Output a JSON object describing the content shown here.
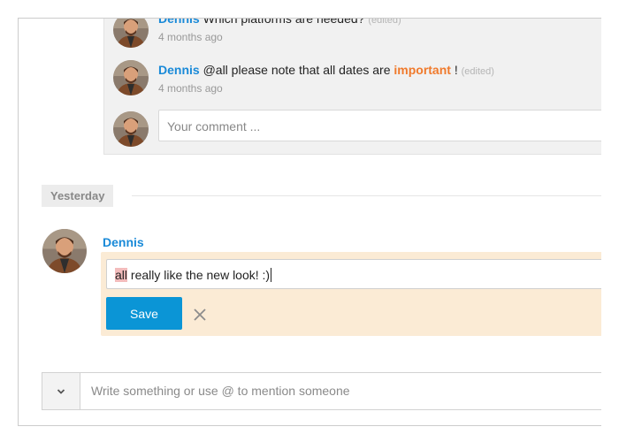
{
  "thread": {
    "comments": [
      {
        "author": "Dennis",
        "text": "Which platforms are needed?",
        "edited": "(edited)",
        "time": "4 months ago"
      },
      {
        "author": "Dennis",
        "text_before": "@all please note that all dates are",
        "highlight": "important",
        "text_after": "!",
        "edited": "(edited)",
        "time": "4 months ago"
      }
    ],
    "comment_placeholder": "Your comment ..."
  },
  "day_divider": "Yesterday",
  "edit": {
    "author": "Dennis",
    "mention": "all",
    "text": " really like the new look! :)",
    "save_label": "Save",
    "cancel_icon": "close-icon"
  },
  "composer": {
    "toggle_icon": "chevron-down-icon",
    "placeholder": "Write something or use @ to mention someone"
  },
  "colors": {
    "author": "#1a8ad8",
    "important": "#f07a2c",
    "save_button": "#0b95d6",
    "edit_background": "#fbebd5",
    "mention_highlight": "#f3bcbc"
  }
}
